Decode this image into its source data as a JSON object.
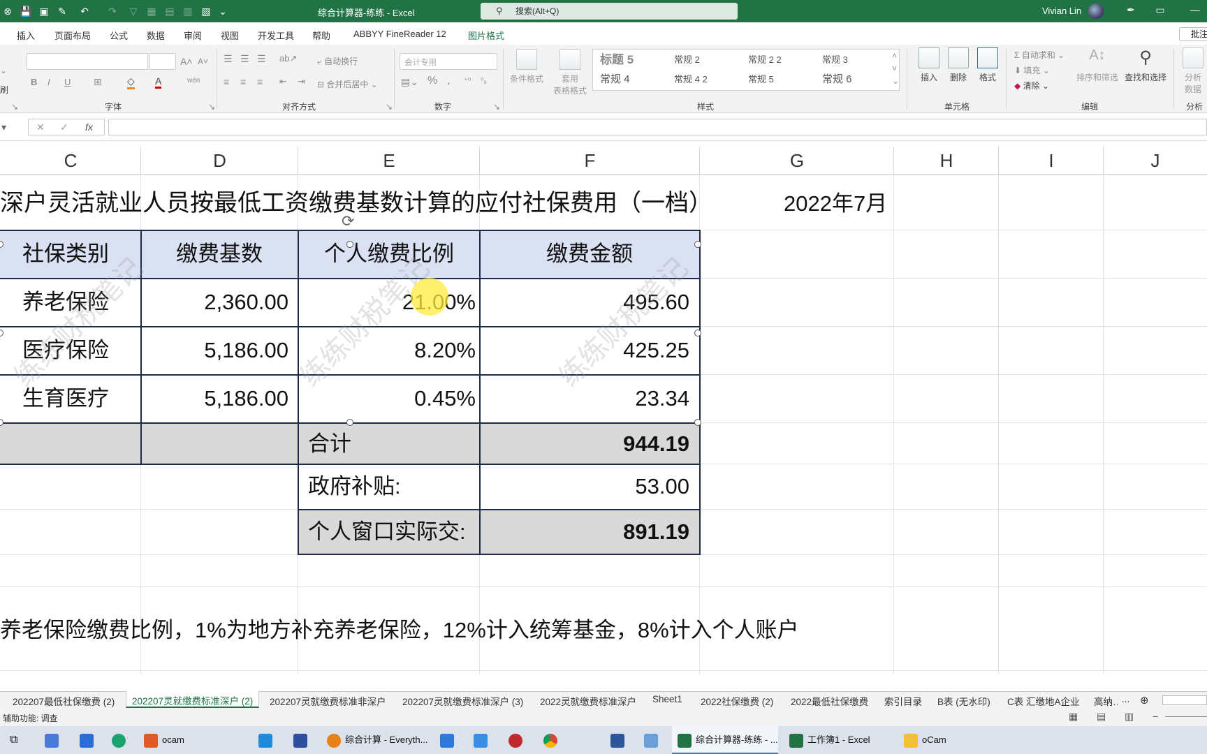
{
  "titlebar": {
    "doc_title": "综合计算器-练练  -  Excel",
    "search_placeholder": "搜索(Alt+Q)",
    "user": "Vivian Lin"
  },
  "ribbon_tabs": [
    "插入",
    "页面布局",
    "公式",
    "数据",
    "审阅",
    "视图",
    "开发工具",
    "帮助",
    "ABBYY FineReader 12",
    "图片格式"
  ],
  "review_button": "批注",
  "ribbon": {
    "format_painter": "刷",
    "font_group": "字体",
    "align_group": "对齐方式",
    "wrap_text": "自动换行",
    "merge_center": "合并后居中",
    "number_group": "数字",
    "number_format": "会计专用",
    "conditional_format": "条件格式",
    "table_format_1": "套用",
    "table_format_2": "表格格式",
    "styles_group": "样式",
    "styles": [
      "标题 5",
      "常规 2",
      "常规 2 2",
      "常规 3",
      "常规 4",
      "常规 4 2",
      "常规 5",
      "常规 6"
    ],
    "cells_group": "单元格",
    "insert": "插入",
    "delete": "删除",
    "format": "格式",
    "autosum": "自动求和",
    "fill": "填充",
    "clear": "清除",
    "sort_filter": "排序和筛选",
    "find_select": "查找和选择",
    "editing_group": "编辑",
    "analyze_1": "分析",
    "analyze_2": "数据",
    "analysis_group": "分析"
  },
  "columns": [
    "C",
    "D",
    "E",
    "F",
    "G",
    "H",
    "I",
    "J"
  ],
  "sheet": {
    "title": "深户灵活就业人员按最低工资缴费基数计算的应付社保费用（一档）",
    "date": "2022年7月",
    "headers": [
      "社保类别",
      "缴费基数",
      "个人缴费比例",
      "缴费金额"
    ],
    "rows": [
      {
        "category": "养老保险",
        "base": "2,360.00",
        "rate": "21.00%",
        "amount": "495.60"
      },
      {
        "category": "医疗保险",
        "base": "5,186.00",
        "rate": "8.20%",
        "amount": "425.25"
      },
      {
        "category": "生育医疗",
        "base": "5,186.00",
        "rate": "0.45%",
        "amount": "23.34"
      }
    ],
    "total_label": "合计",
    "total_value": "944.19",
    "subsidy_label": "政府补贴:",
    "subsidy_value": "53.00",
    "actual_label": "个人窗口实际交:",
    "actual_value": "891.19",
    "note": "养老保险缴费比例，1%为地方补充养老保险，12%计入统筹基金，8%计入个人账户",
    "watermark": "练练财税笔记"
  },
  "sheet_tabs": [
    "202207最低社保缴费 (2)",
    "202207灵就缴费标准深户 (2)",
    "202207灵就缴费标准非深户",
    "202207灵就缴费标准深户 (3)",
    "2022灵就缴费标准深户",
    "Sheet1",
    "2022社保缴费 (2)",
    "2022最低社保缴费",
    "索引目录",
    "B表 (无水印)",
    "C表 汇缴地A企业",
    "高纳…",
    "..."
  ],
  "status_text": "辅助功能: 调查",
  "taskbar": {
    "items": [
      "ocam",
      "综合计算 - Everyth...",
      "综合计算器-练练 - ...",
      "工作簿1 - Excel",
      "oCam"
    ]
  }
}
